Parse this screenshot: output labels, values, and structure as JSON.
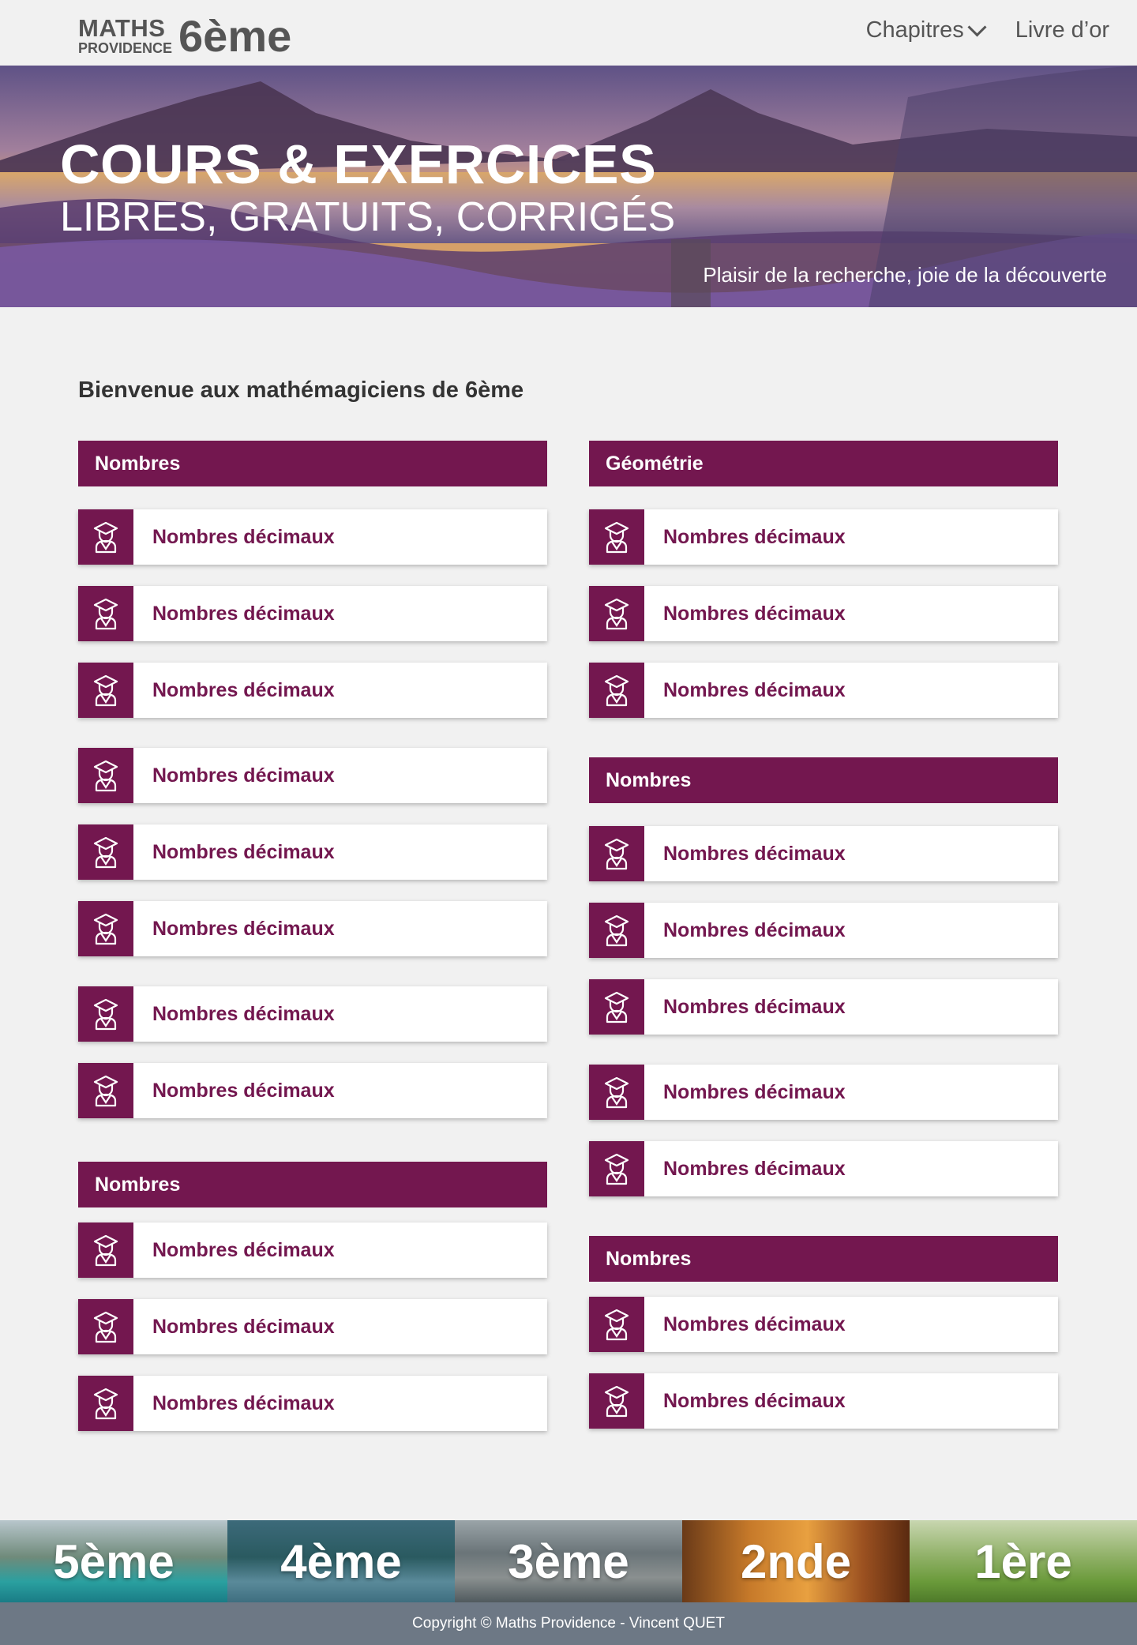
{
  "header": {
    "logo_top": "MATHS",
    "logo_bottom": "PROVIDENCE",
    "logo_level": "6ème",
    "nav": [
      "Chapitres",
      "Livre d’or"
    ]
  },
  "hero": {
    "title": "COURS & EXERCICES",
    "subtitle": "LIBRES, GRATUITS, CORRIGÉS",
    "tagline": "Plaisir de la recherche, joie de la découverte"
  },
  "welcome": "Bienvenue aux mathémagiciens de 6ème",
  "left": {
    "sec1": {
      "title": "Nombres",
      "items": [
        "Nombres décimaux",
        "Nombres décimaux",
        "Nombres décimaux",
        "Nombres décimaux",
        "Nombres décimaux",
        "Nombres décimaux",
        "Nombres décimaux",
        "Nombres décimaux"
      ]
    },
    "sec2": {
      "title": "Nombres",
      "items": [
        "Nombres décimaux",
        "Nombres décimaux",
        "Nombres décimaux"
      ]
    }
  },
  "right": {
    "sec1": {
      "title": "Géométrie",
      "items": [
        "Nombres décimaux",
        "Nombres décimaux",
        "Nombres décimaux"
      ]
    },
    "sec2": {
      "title": "Nombres",
      "items": [
        "Nombres décimaux",
        "Nombres décimaux",
        "Nombres décimaux",
        "Nombres décimaux",
        "Nombres décimaux"
      ]
    },
    "sec3": {
      "title": "Nombres",
      "items": [
        "Nombres décimaux",
        "Nombres décimaux"
      ]
    }
  },
  "levels": [
    "5ème",
    "4ème",
    "3ème",
    "2nde",
    "1ère"
  ],
  "footer": "Copyright © Maths Providence - Vincent QUET",
  "colors": {
    "accent": "#73174f",
    "footer": "#6d7885",
    "background": "#f1f1f1"
  },
  "icons": {
    "card": "graduate-student-icon",
    "nav_dropdown": "chevron-down-icon"
  }
}
